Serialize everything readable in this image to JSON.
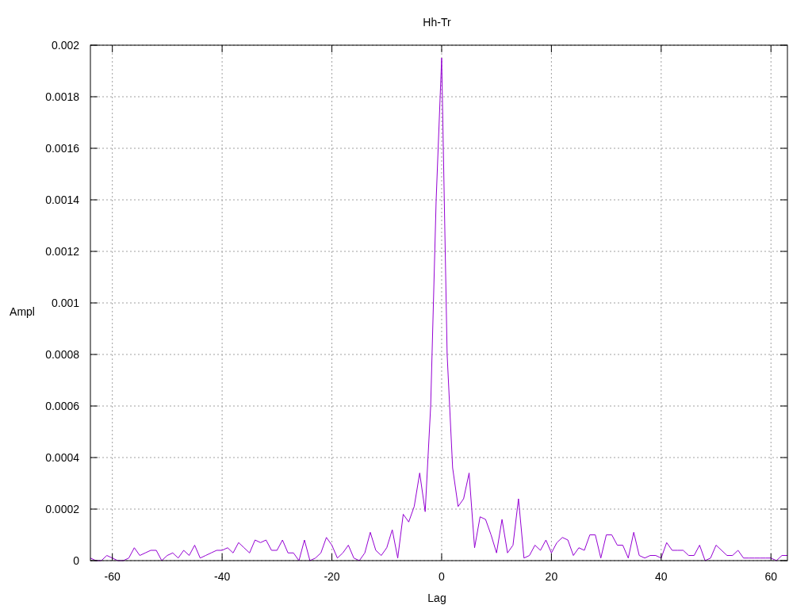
{
  "chart_data": {
    "type": "line",
    "grid": true,
    "title": "Hh-Tr",
    "xlabel": "Lag",
    "ylabel": "Ampl",
    "xlim": [
      -64,
      63
    ],
    "ylim": [
      0,
      0.002
    ],
    "xticks": [
      -60,
      -40,
      -20,
      0,
      20,
      40,
      60
    ],
    "yticks": [
      {
        "value": 0,
        "label": "0"
      },
      {
        "value": 0.0002,
        "label": "0.0002"
      },
      {
        "value": 0.0004,
        "label": "0.0004"
      },
      {
        "value": 0.0006,
        "label": "0.0006"
      },
      {
        "value": 0.0008,
        "label": "0.0008"
      },
      {
        "value": 0.001,
        "label": "0.001"
      },
      {
        "value": 0.0012,
        "label": "0.0012"
      },
      {
        "value": 0.0014,
        "label": "0.0014"
      },
      {
        "value": 0.0016,
        "label": "0.0016"
      },
      {
        "value": 0.0018,
        "label": "0.0018"
      },
      {
        "value": 0.002,
        "label": "0.002"
      }
    ],
    "x": [
      -64,
      -63,
      -62,
      -61,
      -60,
      -59,
      -58,
      -57,
      -56,
      -55,
      -54,
      -53,
      -52,
      -51,
      -50,
      -49,
      -48,
      -47,
      -46,
      -45,
      -44,
      -43,
      -42,
      -41,
      -40,
      -39,
      -38,
      -37,
      -36,
      -35,
      -34,
      -33,
      -32,
      -31,
      -30,
      -29,
      -28,
      -27,
      -26,
      -25,
      -24,
      -23,
      -22,
      -21,
      -20,
      -19,
      -18,
      -17,
      -16,
      -15,
      -14,
      -13,
      -12,
      -11,
      -10,
      -9,
      -8,
      -7,
      -6,
      -5,
      -4,
      -3,
      -2,
      -1,
      0,
      1,
      2,
      3,
      4,
      5,
      6,
      7,
      8,
      9,
      10,
      11,
      12,
      13,
      14,
      15,
      16,
      17,
      18,
      19,
      20,
      21,
      22,
      23,
      24,
      25,
      26,
      27,
      28,
      29,
      30,
      31,
      32,
      33,
      34,
      35,
      36,
      37,
      38,
      39,
      40,
      41,
      42,
      43,
      44,
      45,
      46,
      47,
      48,
      49,
      50,
      51,
      52,
      53,
      54,
      55,
      56,
      57,
      58,
      59,
      60,
      61,
      62,
      63
    ],
    "series": [
      {
        "color": "#9400d3",
        "values": [
          1e-05,
          0,
          0,
          2e-05,
          1e-05,
          0,
          0,
          1e-05,
          5e-05,
          2e-05,
          3e-05,
          4e-05,
          4e-05,
          0,
          2e-05,
          3e-05,
          1e-05,
          4e-05,
          2e-05,
          6e-05,
          1e-05,
          2e-05,
          3e-05,
          4e-05,
          4e-05,
          5e-05,
          3e-05,
          7e-05,
          5e-05,
          3e-05,
          8e-05,
          7e-05,
          8e-05,
          4e-05,
          4e-05,
          8e-05,
          3e-05,
          3e-05,
          0,
          8e-05,
          0,
          1e-05,
          3e-05,
          9e-05,
          6e-05,
          1e-05,
          3e-05,
          6e-05,
          1e-05,
          0,
          3e-05,
          0.00011,
          4e-05,
          2e-05,
          5e-05,
          0.00012,
          1e-05,
          0.00018,
          0.00015,
          0.00021,
          0.00034,
          0.00019,
          0.0006,
          0.0014,
          0.00195,
          0.0008,
          0.00036,
          0.00021,
          0.00024,
          0.00034,
          5e-05,
          0.00017,
          0.00016,
          0.0001,
          3e-05,
          0.00016,
          3e-05,
          6e-05,
          0.00024,
          1e-05,
          2e-05,
          6e-05,
          4e-05,
          8e-05,
          3e-05,
          7e-05,
          9e-05,
          8e-05,
          2e-05,
          5e-05,
          4e-05,
          0.0001,
          0.0001,
          1e-05,
          0.0001,
          0.0001,
          6e-05,
          6e-05,
          1e-05,
          0.00011,
          2e-05,
          1e-05,
          2e-05,
          2e-05,
          1e-05,
          7e-05,
          4e-05,
          4e-05,
          4e-05,
          2e-05,
          2e-05,
          6e-05,
          0,
          1e-05,
          6e-05,
          4e-05,
          2e-05,
          2e-05,
          4e-05,
          1e-05,
          1e-05,
          1e-05,
          1e-05,
          1e-05,
          1e-05,
          0,
          2e-05,
          2e-05
        ]
      }
    ]
  }
}
